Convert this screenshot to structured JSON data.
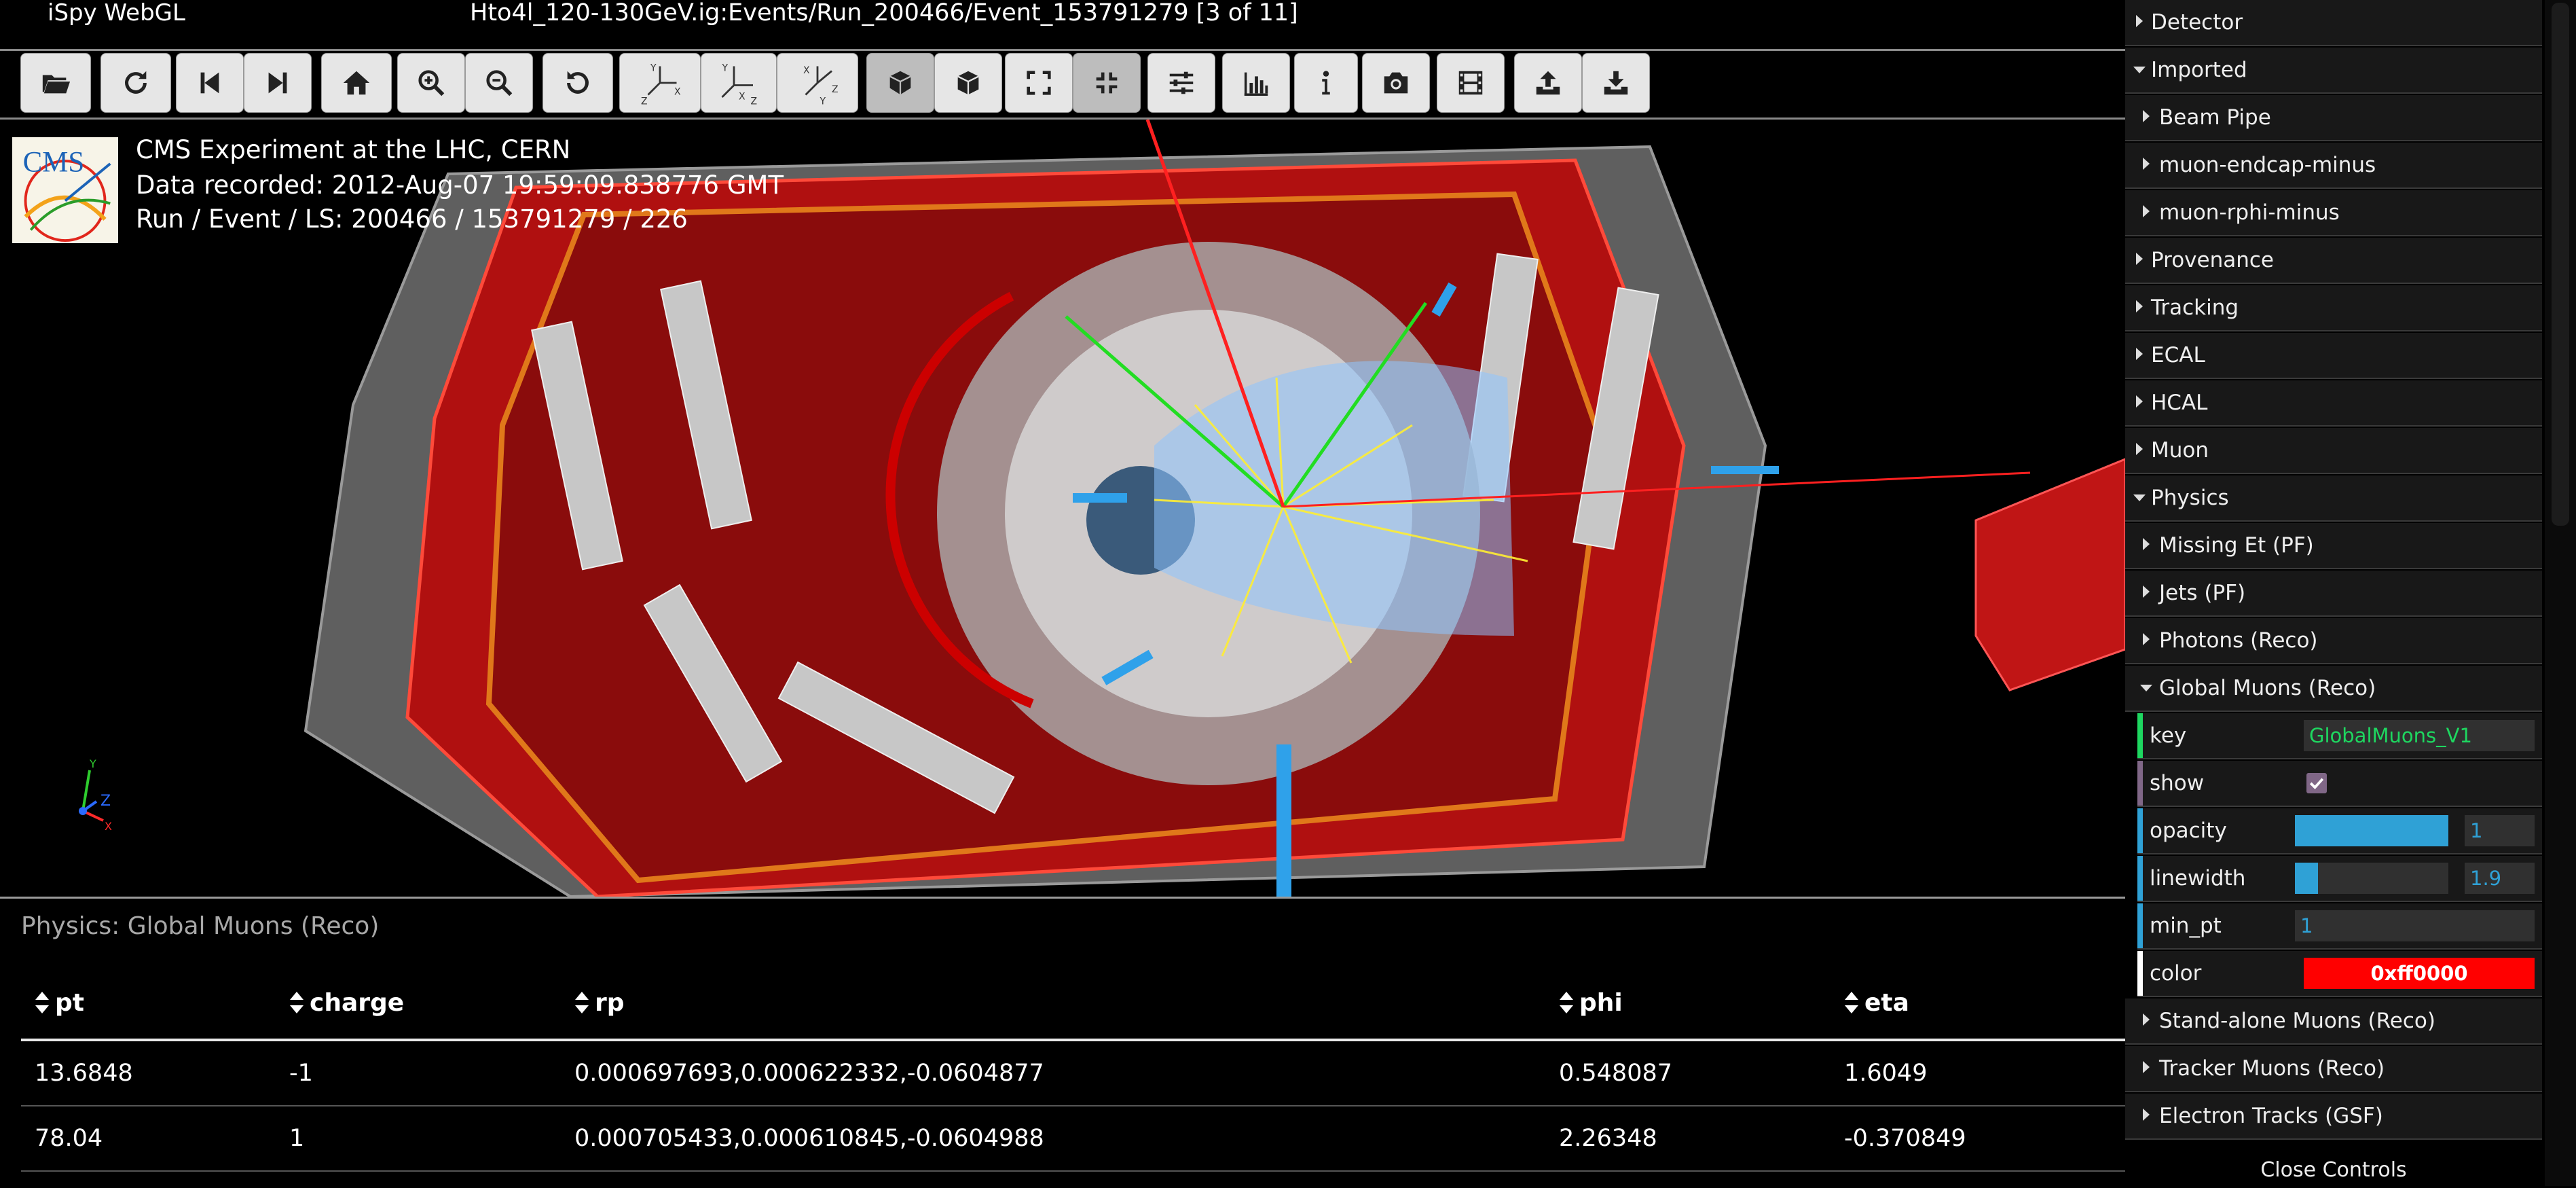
{
  "app": {
    "title": "iSpy WebGL",
    "event_path": "Hto4l_120-130GeV.ig:Events/Run_200466/Event_153791279 [3 of 11]"
  },
  "toolbar": {
    "buttons": [
      "open-file",
      "reload",
      "previous-event",
      "next-event",
      "home",
      "zoom-in",
      "zoom-out",
      "reset-rotation",
      "view-yx",
      "view-xz",
      "view-yz",
      "perspective",
      "orthographic",
      "fullscreen",
      "exit-fullscreen",
      "settings",
      "chart",
      "info",
      "screenshot",
      "animate",
      "export",
      "import"
    ]
  },
  "overlay": {
    "line1": "CMS Experiment at the LHC, CERN",
    "line2": "Data recorded: 2012-Aug-07 19:59:09.838776 GMT",
    "line3": "Run / Event / LS: 200466 / 153791279 / 226",
    "logo_text": "CMS"
  },
  "gizmo": {
    "x": "X",
    "y": "Y",
    "z": "Z"
  },
  "table": {
    "title": "Physics: Global Muons (Reco)",
    "columns": [
      "pt",
      "charge",
      "rp",
      "phi",
      "eta"
    ],
    "rows": [
      [
        "13.6848",
        "-1",
        "0.000697693,0.000622332,-0.0604877",
        "0.548087",
        "1.6049"
      ],
      [
        "78.04",
        "1",
        "0.000705433,0.000610845,-0.0604988",
        "2.26348",
        "-0.370849"
      ]
    ]
  },
  "panel": {
    "items": [
      {
        "label": "Detector",
        "state": "collapsed",
        "level": 0
      },
      {
        "label": "Imported",
        "state": "expanded",
        "level": 0
      },
      {
        "label": "Beam Pipe",
        "state": "collapsed",
        "level": 1
      },
      {
        "label": "muon-endcap-minus",
        "state": "collapsed",
        "level": 1
      },
      {
        "label": "muon-rphi-minus",
        "state": "collapsed",
        "level": 1
      },
      {
        "label": "Provenance",
        "state": "collapsed",
        "level": 0
      },
      {
        "label": "Tracking",
        "state": "collapsed",
        "level": 0
      },
      {
        "label": "ECAL",
        "state": "collapsed",
        "level": 0
      },
      {
        "label": "HCAL",
        "state": "collapsed",
        "level": 0
      },
      {
        "label": "Muon",
        "state": "collapsed",
        "level": 0
      },
      {
        "label": "Physics",
        "state": "expanded",
        "level": 0
      },
      {
        "label": "Missing Et (PF)",
        "state": "collapsed",
        "level": 1
      },
      {
        "label": "Jets (PF)",
        "state": "collapsed",
        "level": 1
      },
      {
        "label": "Photons (Reco)",
        "state": "collapsed",
        "level": 1
      },
      {
        "label": "Global Muons (Reco)",
        "state": "expanded",
        "level": 1
      }
    ],
    "controls": {
      "key": {
        "label": "key",
        "value": "GlobalMuons_V1",
        "color": "#1ed760"
      },
      "show": {
        "label": "show",
        "checked": true,
        "color": "#806787"
      },
      "opacity": {
        "label": "opacity",
        "value": "1",
        "fill": 1.0,
        "color": "#2fa1d6"
      },
      "linewidth": {
        "label": "linewidth",
        "value": "1.9",
        "fill": 0.15,
        "color": "#2fa1d6"
      },
      "min_pt": {
        "label": "min_pt",
        "value": "1",
        "color": "#2fa1d6"
      },
      "color": {
        "label": "color",
        "value": "0xff0000",
        "swatch": "#ff0000"
      }
    },
    "after_items": [
      {
        "label": "Stand-alone Muons (Reco)",
        "state": "collapsed",
        "level": 1
      },
      {
        "label": "Tracker Muons (Reco)",
        "state": "collapsed",
        "level": 1
      },
      {
        "label": "Electron Tracks (GSF)",
        "state": "collapsed",
        "level": 1
      }
    ],
    "close_label": "Close Controls"
  }
}
